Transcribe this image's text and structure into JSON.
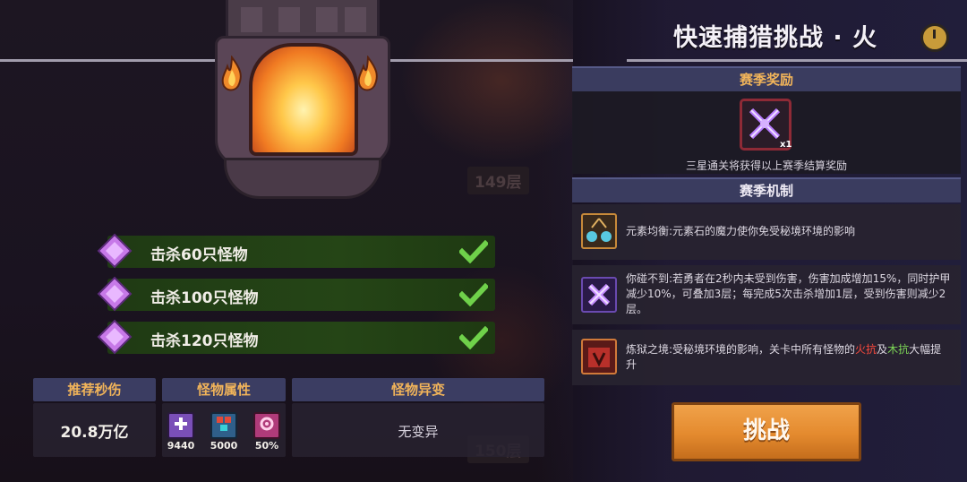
{
  "header": {
    "title": "快速捕猎挑战 · 火",
    "timer_icon": "stopwatch-icon"
  },
  "background": {
    "floor_upper": "149层",
    "floor_lower": "150层"
  },
  "objectives": [
    {
      "label": "击杀60只怪物",
      "completed": true
    },
    {
      "label": "击杀100只怪物",
      "completed": true
    },
    {
      "label": "击杀120只怪物",
      "completed": true
    }
  ],
  "stats": {
    "recommended_dps": {
      "label": "推荐秒伤",
      "value": "20.8万亿"
    },
    "monster_attributes": {
      "label": "怪物属性",
      "items": [
        {
          "icon": "shield-plus-icon",
          "value": "9440"
        },
        {
          "icon": "monster-group-icon",
          "value": "5000"
        },
        {
          "icon": "crit-icon",
          "value": "50%"
        }
      ]
    },
    "monster_mutation": {
      "label": "怪物异变",
      "value": "无变异"
    }
  },
  "season_reward": {
    "label": "赛季奖励",
    "item_icon": "crossed-swords-icon",
    "quantity": "x1",
    "note": "三星通关将获得以上赛季结算奖励"
  },
  "season_mechanics": {
    "label": "赛季机制",
    "items": [
      {
        "icon": "elemental-balance-icon",
        "text": "元素均衡:元素石的魔力使你免受秘境环境的影响"
      },
      {
        "icon": "untouchable-icon",
        "text": "你碰不到:若勇者在2秒内未受到伤害，伤害加成增加15%，同时护甲减少10%，可叠加3层；每完成5次击杀增加1层，受到伤害则减少2层。"
      },
      {
        "icon": "inferno-realm-icon",
        "text_before": "炼狱之境:受秘境环境的影响，关卡中所有怪物的",
        "highlight_fire": "火抗",
        "text_mid": "及",
        "highlight_wood": "木抗",
        "text_after": "大幅提升"
      }
    ]
  },
  "actions": {
    "challenge_label": "挑战"
  },
  "colors": {
    "objective_bg": "#254516",
    "check_green": "#6fd14a",
    "stat_label": "#f1b45a",
    "panel_header": "#3a3c5f",
    "challenge_button": "#e48a2e",
    "fire_resist": "#ff4a3d",
    "wood_resist": "#7ed957"
  }
}
